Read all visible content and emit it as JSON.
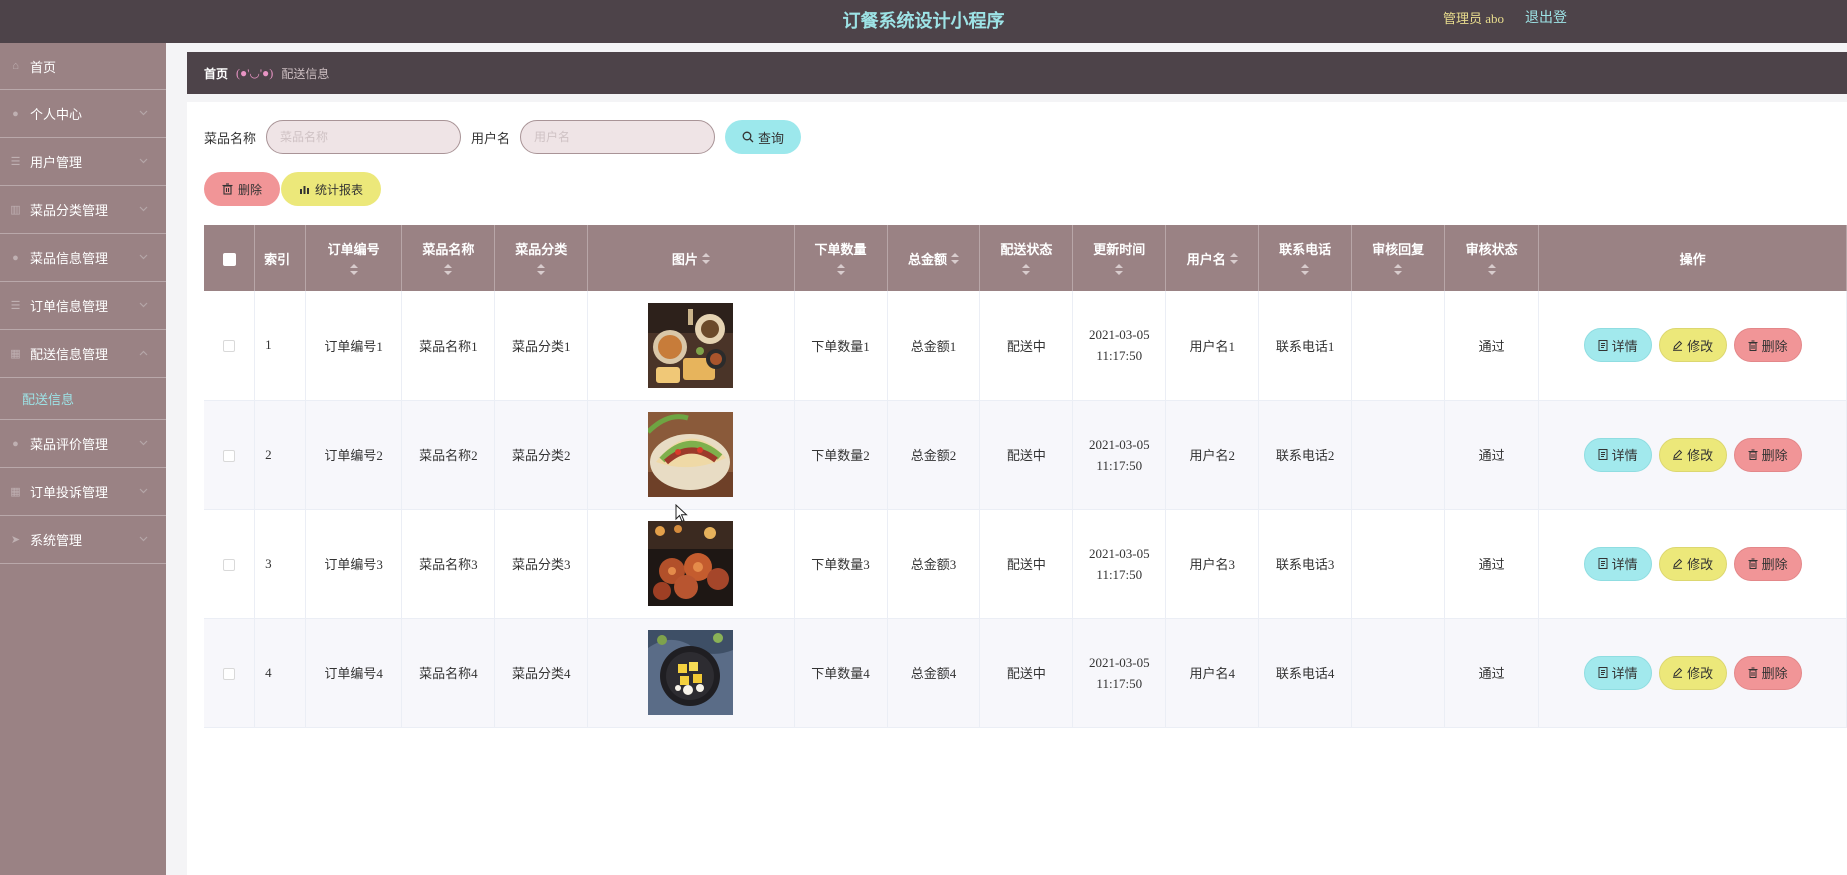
{
  "header": {
    "title": "订餐系统设计小程序",
    "admin_label": "管理员 abo",
    "logout_label": "退出登录"
  },
  "sidebar": {
    "items": [
      {
        "label": "首页",
        "icon": "home-icon",
        "glyph": "⌂",
        "arrow": false
      },
      {
        "label": "个人中心",
        "icon": "user-icon",
        "glyph": "●",
        "arrow": true
      },
      {
        "label": "用户管理",
        "icon": "list-icon",
        "glyph": "☰",
        "arrow": true
      },
      {
        "label": "菜品分类管理",
        "icon": "bar-chart-icon",
        "glyph": "▥",
        "arrow": true
      },
      {
        "label": "菜品信息管理",
        "icon": "circle-icon",
        "glyph": "●",
        "arrow": true
      },
      {
        "label": "订单信息管理",
        "icon": "list-icon",
        "glyph": "☰",
        "arrow": true
      },
      {
        "label": "配送信息管理",
        "icon": "grid-icon",
        "glyph": "▦",
        "arrow": true,
        "open": true,
        "sub": "配送信息"
      },
      {
        "label": "菜品评价管理",
        "icon": "user-icon",
        "glyph": "●",
        "arrow": true
      },
      {
        "label": "订单投诉管理",
        "icon": "grid-icon",
        "glyph": "▦",
        "arrow": true
      },
      {
        "label": "系统管理",
        "icon": "send-icon",
        "glyph": "➤",
        "arrow": true
      }
    ]
  },
  "breadcrumb": {
    "home": "首页",
    "separator": "(●'◡'●)",
    "current": "配送信息"
  },
  "search": {
    "dish_label": "菜品名称",
    "dish_placeholder": "菜品名称",
    "user_label": "用户名",
    "user_placeholder": "用户名",
    "query_label": "查询"
  },
  "actions": {
    "delete_label": "删除",
    "stats_label": "统计报表"
  },
  "table": {
    "columns": [
      "索引",
      "订单编号",
      "菜品名称",
      "菜品分类",
      "图片",
      "下单数量",
      "总金额",
      "配送状态",
      "更新时间",
      "用户名",
      "联系电话",
      "审核回复",
      "审核状态",
      "操作"
    ],
    "rows": [
      {
        "index": "1",
        "order_no": "订单编号1",
        "dish": "菜品名称1",
        "category": "菜品分类1",
        "quantity": "下单数量1",
        "amount": "总金额1",
        "status": "配送中",
        "date": "2021-03-05",
        "time": "11:17:50",
        "username": "用户名1",
        "phone": "联系电话1",
        "reply": "",
        "audit": "通过",
        "image": "food-photo-platter"
      },
      {
        "index": "2",
        "order_no": "订单编号2",
        "dish": "菜品名称2",
        "category": "菜品分类2",
        "quantity": "下单数量2",
        "amount": "总金额2",
        "status": "配送中",
        "date": "2021-03-05",
        "time": "11:17:50",
        "username": "用户名2",
        "phone": "联系电话2",
        "reply": "",
        "audit": "通过",
        "image": "food-photo-tacos"
      },
      {
        "index": "3",
        "order_no": "订单编号3",
        "dish": "菜品名称3",
        "category": "菜品分类3",
        "quantity": "下单数量3",
        "amount": "总金额3",
        "status": "配送中",
        "date": "2021-03-05",
        "time": "11:17:50",
        "username": "用户名3",
        "phone": "联系电话3",
        "reply": "",
        "audit": "通过",
        "image": "food-photo-grill"
      },
      {
        "index": "4",
        "order_no": "订单编号4",
        "dish": "菜品名称4",
        "category": "菜品分类4",
        "quantity": "下单数量4",
        "amount": "总金额4",
        "status": "配送中",
        "date": "2021-03-05",
        "time": "11:17:50",
        "username": "用户名4",
        "phone": "联系电话4",
        "reply": "",
        "audit": "通过",
        "image": "food-photo-bowl"
      }
    ],
    "row_buttons": {
      "detail": "详情",
      "edit": "修改",
      "delete": "删除"
    }
  },
  "colors": {
    "header_bg": "#4d4349",
    "sidebar_bg": "#9a8284",
    "accent_cyan": "#9ce8ec",
    "accent_yellow": "#ece87a",
    "accent_red": "#f19597"
  }
}
